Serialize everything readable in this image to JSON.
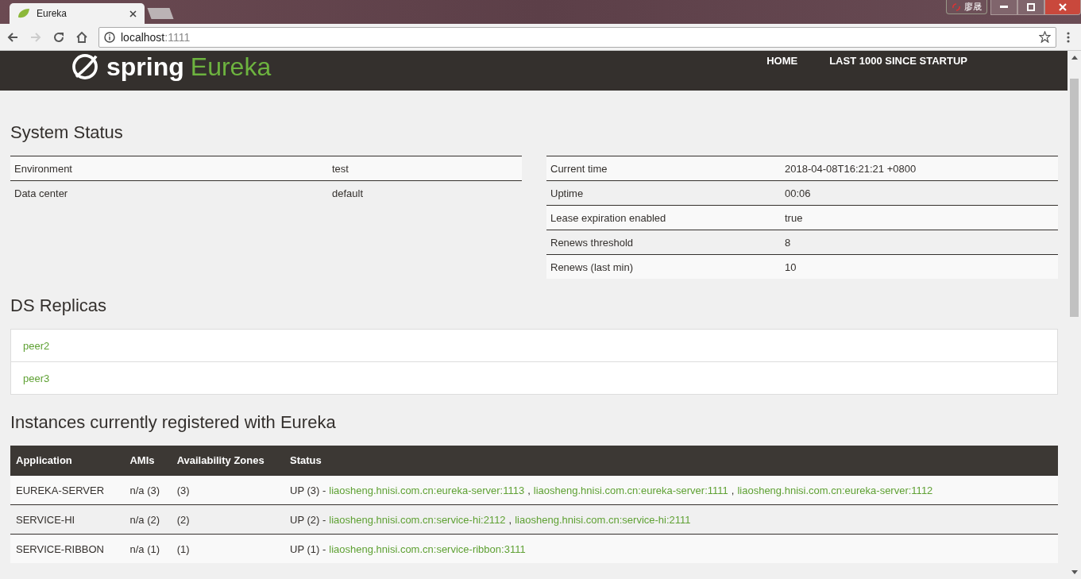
{
  "browser": {
    "tab_title": "Eureka",
    "address": {
      "host": "localhost",
      "port": ":1111"
    },
    "user_badge": "廖晟"
  },
  "header": {
    "logo": {
      "word": "spring",
      "product": "Eureka"
    },
    "nav": [
      {
        "label": "HOME"
      },
      {
        "label": "LAST 1000 SINCE STARTUP"
      }
    ]
  },
  "system_status": {
    "title": "System Status",
    "left": [
      {
        "label": "Environment",
        "value": "test"
      },
      {
        "label": "Data center",
        "value": "default"
      }
    ],
    "right": [
      {
        "label": "Current time",
        "value": "2018-04-08T16:21:21 +0800"
      },
      {
        "label": "Uptime",
        "value": "00:06"
      },
      {
        "label": "Lease expiration enabled",
        "value": "true"
      },
      {
        "label": "Renews threshold",
        "value": "8"
      },
      {
        "label": "Renews (last min)",
        "value": "10"
      }
    ]
  },
  "ds_replicas": {
    "title": "DS Replicas",
    "items": [
      "peer2",
      "peer3"
    ]
  },
  "instances": {
    "title": "Instances currently registered with Eureka",
    "columns": [
      "Application",
      "AMIs",
      "Availability Zones",
      "Status"
    ],
    "separator": ",",
    "rows": [
      {
        "application": "EUREKA-SERVER",
        "amis": "n/a (3)",
        "zones": "(3)",
        "status": "UP (3) -",
        "links": [
          "liaosheng.hnisi.com.cn:eureka-server:1113",
          "liaosheng.hnisi.com.cn:eureka-server:1111",
          "liaosheng.hnisi.com.cn:eureka-server:1112"
        ]
      },
      {
        "application": "SERVICE-HI",
        "amis": "n/a (2)",
        "zones": "(2)",
        "status": "UP (2) -",
        "links": [
          "liaosheng.hnisi.com.cn:service-hi:2112",
          "liaosheng.hnisi.com.cn:service-hi:2111"
        ]
      },
      {
        "application": "SERVICE-RIBBON",
        "amis": "n/a (1)",
        "zones": "(1)",
        "status": "UP (1) -",
        "links": [
          "liaosheng.hnisi.com.cn:service-ribbon:3111"
        ]
      }
    ]
  }
}
